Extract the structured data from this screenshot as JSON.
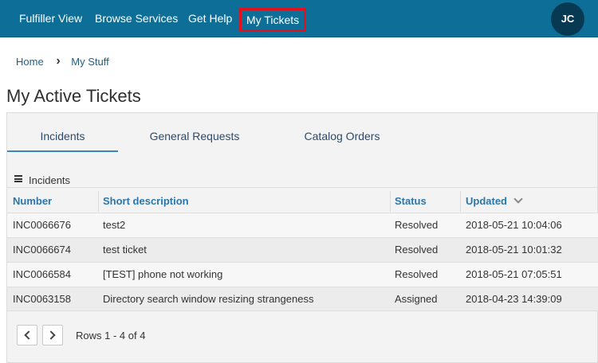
{
  "nav": {
    "items": [
      {
        "label": "Fulfiller View"
      },
      {
        "label": "Browse Services"
      },
      {
        "label": "Get Help"
      },
      {
        "label": "My Tickets"
      }
    ],
    "active_index": 3,
    "avatar_initials": "JC"
  },
  "breadcrumb": {
    "items": [
      "Home",
      "My Stuff"
    ]
  },
  "page": {
    "title": "My Active Tickets"
  },
  "tabs": [
    {
      "label": "Incidents"
    },
    {
      "label": "General Requests"
    },
    {
      "label": "Catalog Orders"
    }
  ],
  "active_tab": 0,
  "list": {
    "title": "Incidents",
    "columns": [
      "Number",
      "Short description",
      "Status",
      "Updated"
    ],
    "sort_column": "Updated",
    "rows": [
      {
        "number": "INC0066676",
        "description": "test2",
        "status": "Resolved",
        "updated": "2018-05-21 10:04:06"
      },
      {
        "number": "INC0066674",
        "description": "test ticket",
        "status": "Resolved",
        "updated": "2018-05-21 10:01:32"
      },
      {
        "number": "INC0066584",
        "description": "[TEST] phone not working",
        "status": "Resolved",
        "updated": "2018-05-21 07:05:51"
      },
      {
        "number": "INC0063158",
        "description": "Directory search window resizing strangeness",
        "status": "Assigned",
        "updated": "2018-04-23 14:39:09"
      }
    ]
  },
  "pager": {
    "info": "Rows 1 - 4 of 4"
  },
  "colors": {
    "nav_bg": "#0d6e97",
    "highlight": "#e3101d",
    "header_link": "#2a76ad"
  },
  "icons": {
    "list_menu": "hamburger-icon",
    "sort": "chevron-down-icon",
    "prev": "chevron-left-icon",
    "next": "chevron-right-icon",
    "breadcrumb_sep": "chevron-right-icon"
  }
}
